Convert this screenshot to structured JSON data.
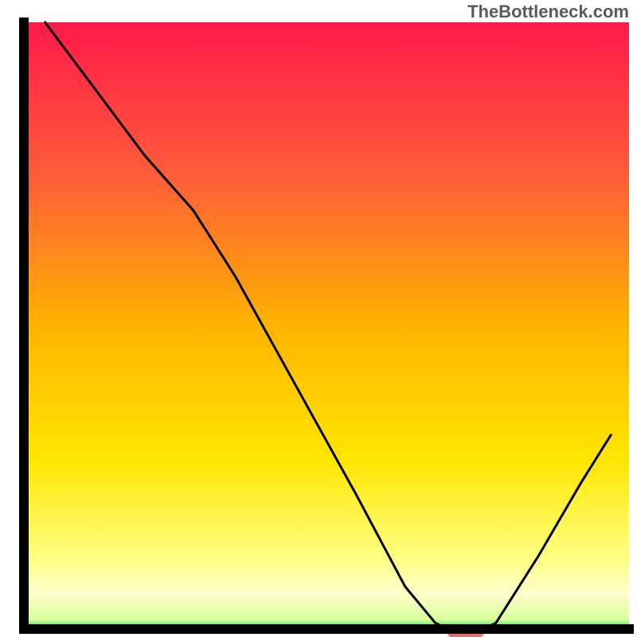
{
  "attribution": "TheBottleneck.com",
  "chart_data": {
    "type": "line",
    "title": "",
    "xlabel": "",
    "ylabel": "",
    "x_range": [
      0,
      100
    ],
    "y_range": [
      0,
      100
    ],
    "gradient_stops": [
      {
        "offset": 0,
        "color": "#ff1a4a"
      },
      {
        "offset": 0.25,
        "color": "#ff5c3a"
      },
      {
        "offset": 0.5,
        "color": "#ffb300"
      },
      {
        "offset": 0.72,
        "color": "#ffe600"
      },
      {
        "offset": 0.88,
        "color": "#ffff80"
      },
      {
        "offset": 0.94,
        "color": "#ffffcc"
      },
      {
        "offset": 0.985,
        "color": "#d8ff9a"
      },
      {
        "offset": 1.0,
        "color": "#00e060"
      }
    ],
    "curve_points": [
      {
        "x": 3.5,
        "y": 100
      },
      {
        "x": 20,
        "y": 78
      },
      {
        "x": 28,
        "y": 69
      },
      {
        "x": 35,
        "y": 58
      },
      {
        "x": 45,
        "y": 40
      },
      {
        "x": 55,
        "y": 22
      },
      {
        "x": 63,
        "y": 7
      },
      {
        "x": 68,
        "y": 1
      },
      {
        "x": 70,
        "y": 0
      },
      {
        "x": 76,
        "y": 0
      },
      {
        "x": 78,
        "y": 1
      },
      {
        "x": 85,
        "y": 12
      },
      {
        "x": 92,
        "y": 24
      },
      {
        "x": 97,
        "y": 32
      }
    ],
    "marker": {
      "x": 73,
      "y": 0,
      "color": "#e36f6f",
      "width": 6,
      "height": 2
    },
    "annotations": []
  }
}
